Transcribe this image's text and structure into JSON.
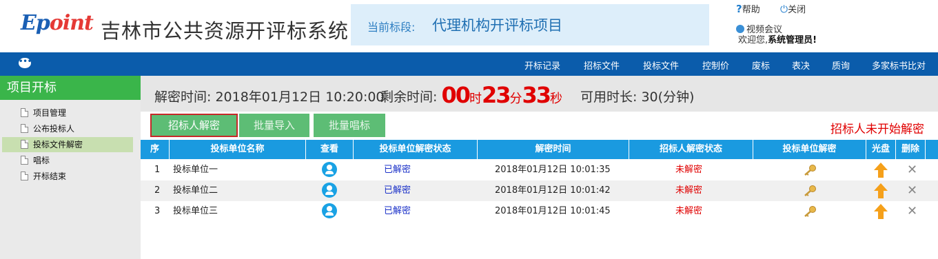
{
  "header": {
    "logo_text_a": "Ep",
    "logo_text_b": "oint",
    "system_title": "吉林市公共资源开评标系统",
    "current_label": "当前标段:",
    "current_value": "代理机构开评标项目",
    "help": "帮助",
    "close": "关闭",
    "video": "视频会议",
    "welcome_prefix": "欢迎您,",
    "welcome_user": "系统管理员!"
  },
  "nav": [
    "开标记录",
    "招标文件",
    "投标文件",
    "控制价",
    "废标",
    "表决",
    "质询",
    "多家标书比对"
  ],
  "sidebar": {
    "title": "项目开标",
    "items": [
      "项目管理",
      "公布投标人",
      "投标文件解密",
      "唱标",
      "开标结束"
    ],
    "active_index": 2
  },
  "info": {
    "decrypt_time": "解密时间: 2018年01月12日 10:20:00",
    "remaining_label": "剩余时间:",
    "hours": "00",
    "hours_unit": "时",
    "minutes": "23",
    "minutes_unit": "分",
    "seconds": "33",
    "seconds_unit": "秒",
    "available": "可用时长: 30(分钟)"
  },
  "actions": {
    "decrypt_button": "招标人解密",
    "import_button": "批量导入",
    "sing_button": "批量唱标",
    "status_message": "招标人未开始解密"
  },
  "table": {
    "columns": [
      "序",
      "投标单位名称",
      "查看",
      "投标单位解密状态",
      "解密时间",
      "招标人解密状态",
      "投标单位解密",
      "光盘",
      "删除"
    ],
    "rows": [
      {
        "no": "1",
        "name": "投标单位一",
        "bidder_status": "已解密",
        "time": "2018年01月12日 10:01:35",
        "tenderer_status": "未解密"
      },
      {
        "no": "2",
        "name": "投标单位二",
        "bidder_status": "已解密",
        "time": "2018年01月12日 10:01:42",
        "tenderer_status": "未解密"
      },
      {
        "no": "3",
        "name": "投标单位三",
        "bidder_status": "已解密",
        "time": "2018年01月12日 10:01:45",
        "tenderer_status": "未解密"
      }
    ]
  },
  "colors": {
    "nav_bg": "#0b5cab",
    "sidebar_title_bg": "#3ab54a",
    "table_header_bg": "#1a9ae0",
    "button_bg": "#5dbd75",
    "alert": "#e00000"
  }
}
